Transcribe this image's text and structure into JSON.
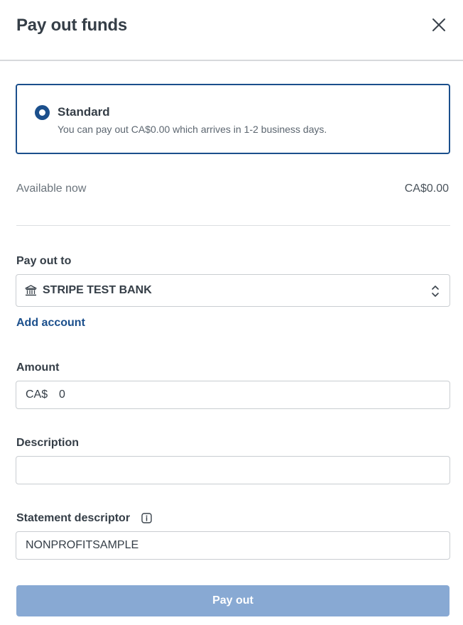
{
  "dialog": {
    "title": "Pay out funds"
  },
  "payout_option": {
    "title": "Standard",
    "description": "You can pay out CA$0.00 which arrives in 1-2 business days.",
    "selected": true
  },
  "available": {
    "label": "Available now",
    "value": "CA$0.00"
  },
  "pay_out_to": {
    "label": "Pay out to",
    "selected_account": "STRIPE TEST BANK",
    "add_account_label": "Add account"
  },
  "amount": {
    "label": "Amount",
    "currency_prefix": "CA$",
    "value": "0"
  },
  "description": {
    "label": "Description",
    "value": ""
  },
  "statement_descriptor": {
    "label": "Statement descriptor",
    "value": "NONPROFITSAMPLE"
  },
  "actions": {
    "pay_out_label": "Pay out"
  },
  "icons": {
    "close": "close-icon",
    "bank": "bank-icon",
    "select_arrows": "chevron-updown-icon",
    "info": "info-icon"
  },
  "colors": {
    "primary": "#1b4f8c",
    "button_disabled": "#88a9d3",
    "border": "#c9cdd1"
  }
}
